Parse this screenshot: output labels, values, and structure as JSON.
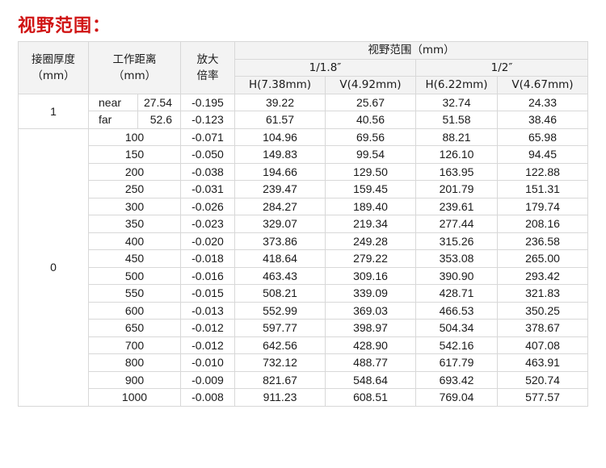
{
  "title": "视野范围：",
  "headers": {
    "thickness": "接圈厚度\n（mm）",
    "distance": "工作距离\n（mm）",
    "magnification": "放大\n倍率",
    "fov": "视野范围（mm）",
    "sensor_a": "1/1.8″",
    "sensor_b": "1/2″",
    "col_h_a": "H(7.38mm)",
    "col_v_a": "V(4.92mm)",
    "col_h_b": "H(6.22mm)",
    "col_v_b": "V(4.67mm)"
  },
  "group1": {
    "thickness": "1",
    "rows": [
      {
        "label": "near",
        "dist": "27.54",
        "mag": "-0.195",
        "h1": "39.22",
        "v1": "25.67",
        "h2": "32.74",
        "v2": "24.33"
      },
      {
        "label": "far",
        "dist": "52.6",
        "mag": "-0.123",
        "h1": "61.57",
        "v1": "40.56",
        "h2": "51.58",
        "v2": "38.46"
      }
    ]
  },
  "group0": {
    "thickness": "0",
    "rows": [
      {
        "dist": "100",
        "mag": "-0.071",
        "h1": "104.96",
        "v1": "69.56",
        "h2": "88.21",
        "v2": "65.98"
      },
      {
        "dist": "150",
        "mag": "-0.050",
        "h1": "149.83",
        "v1": "99.54",
        "h2": "126.10",
        "v2": "94.45"
      },
      {
        "dist": "200",
        "mag": "-0.038",
        "h1": "194.66",
        "v1": "129.50",
        "h2": "163.95",
        "v2": "122.88"
      },
      {
        "dist": "250",
        "mag": "-0.031",
        "h1": "239.47",
        "v1": "159.45",
        "h2": "201.79",
        "v2": "151.31"
      },
      {
        "dist": "300",
        "mag": "-0.026",
        "h1": "284.27",
        "v1": "189.40",
        "h2": "239.61",
        "v2": "179.74"
      },
      {
        "dist": "350",
        "mag": "-0.023",
        "h1": "329.07",
        "v1": "219.34",
        "h2": "277.44",
        "v2": "208.16"
      },
      {
        "dist": "400",
        "mag": "-0.020",
        "h1": "373.86",
        "v1": "249.28",
        "h2": "315.26",
        "v2": "236.58"
      },
      {
        "dist": "450",
        "mag": "-0.018",
        "h1": "418.64",
        "v1": "279.22",
        "h2": "353.08",
        "v2": "265.00"
      },
      {
        "dist": "500",
        "mag": "-0.016",
        "h1": "463.43",
        "v1": "309.16",
        "h2": "390.90",
        "v2": "293.42"
      },
      {
        "dist": "550",
        "mag": "-0.015",
        "h1": "508.21",
        "v1": "339.09",
        "h2": "428.71",
        "v2": "321.83"
      },
      {
        "dist": "600",
        "mag": "-0.013",
        "h1": "552.99",
        "v1": "369.03",
        "h2": "466.53",
        "v2": "350.25"
      },
      {
        "dist": "650",
        "mag": "-0.012",
        "h1": "597.77",
        "v1": "398.97",
        "h2": "504.34",
        "v2": "378.67"
      },
      {
        "dist": "700",
        "mag": "-0.012",
        "h1": "642.56",
        "v1": "428.90",
        "h2": "542.16",
        "v2": "407.08"
      },
      {
        "dist": "800",
        "mag": "-0.010",
        "h1": "732.12",
        "v1": "488.77",
        "h2": "617.79",
        "v2": "463.91"
      },
      {
        "dist": "900",
        "mag": "-0.009",
        "h1": "821.67",
        "v1": "548.64",
        "h2": "693.42",
        "v2": "520.74"
      },
      {
        "dist": "1000",
        "mag": "-0.008",
        "h1": "911.23",
        "v1": "608.51",
        "h2": "769.04",
        "v2": "577.57"
      }
    ]
  },
  "colors": {
    "title": "#d01414",
    "header_bg": "#f3f3f3",
    "border": "#d8d8d8"
  }
}
